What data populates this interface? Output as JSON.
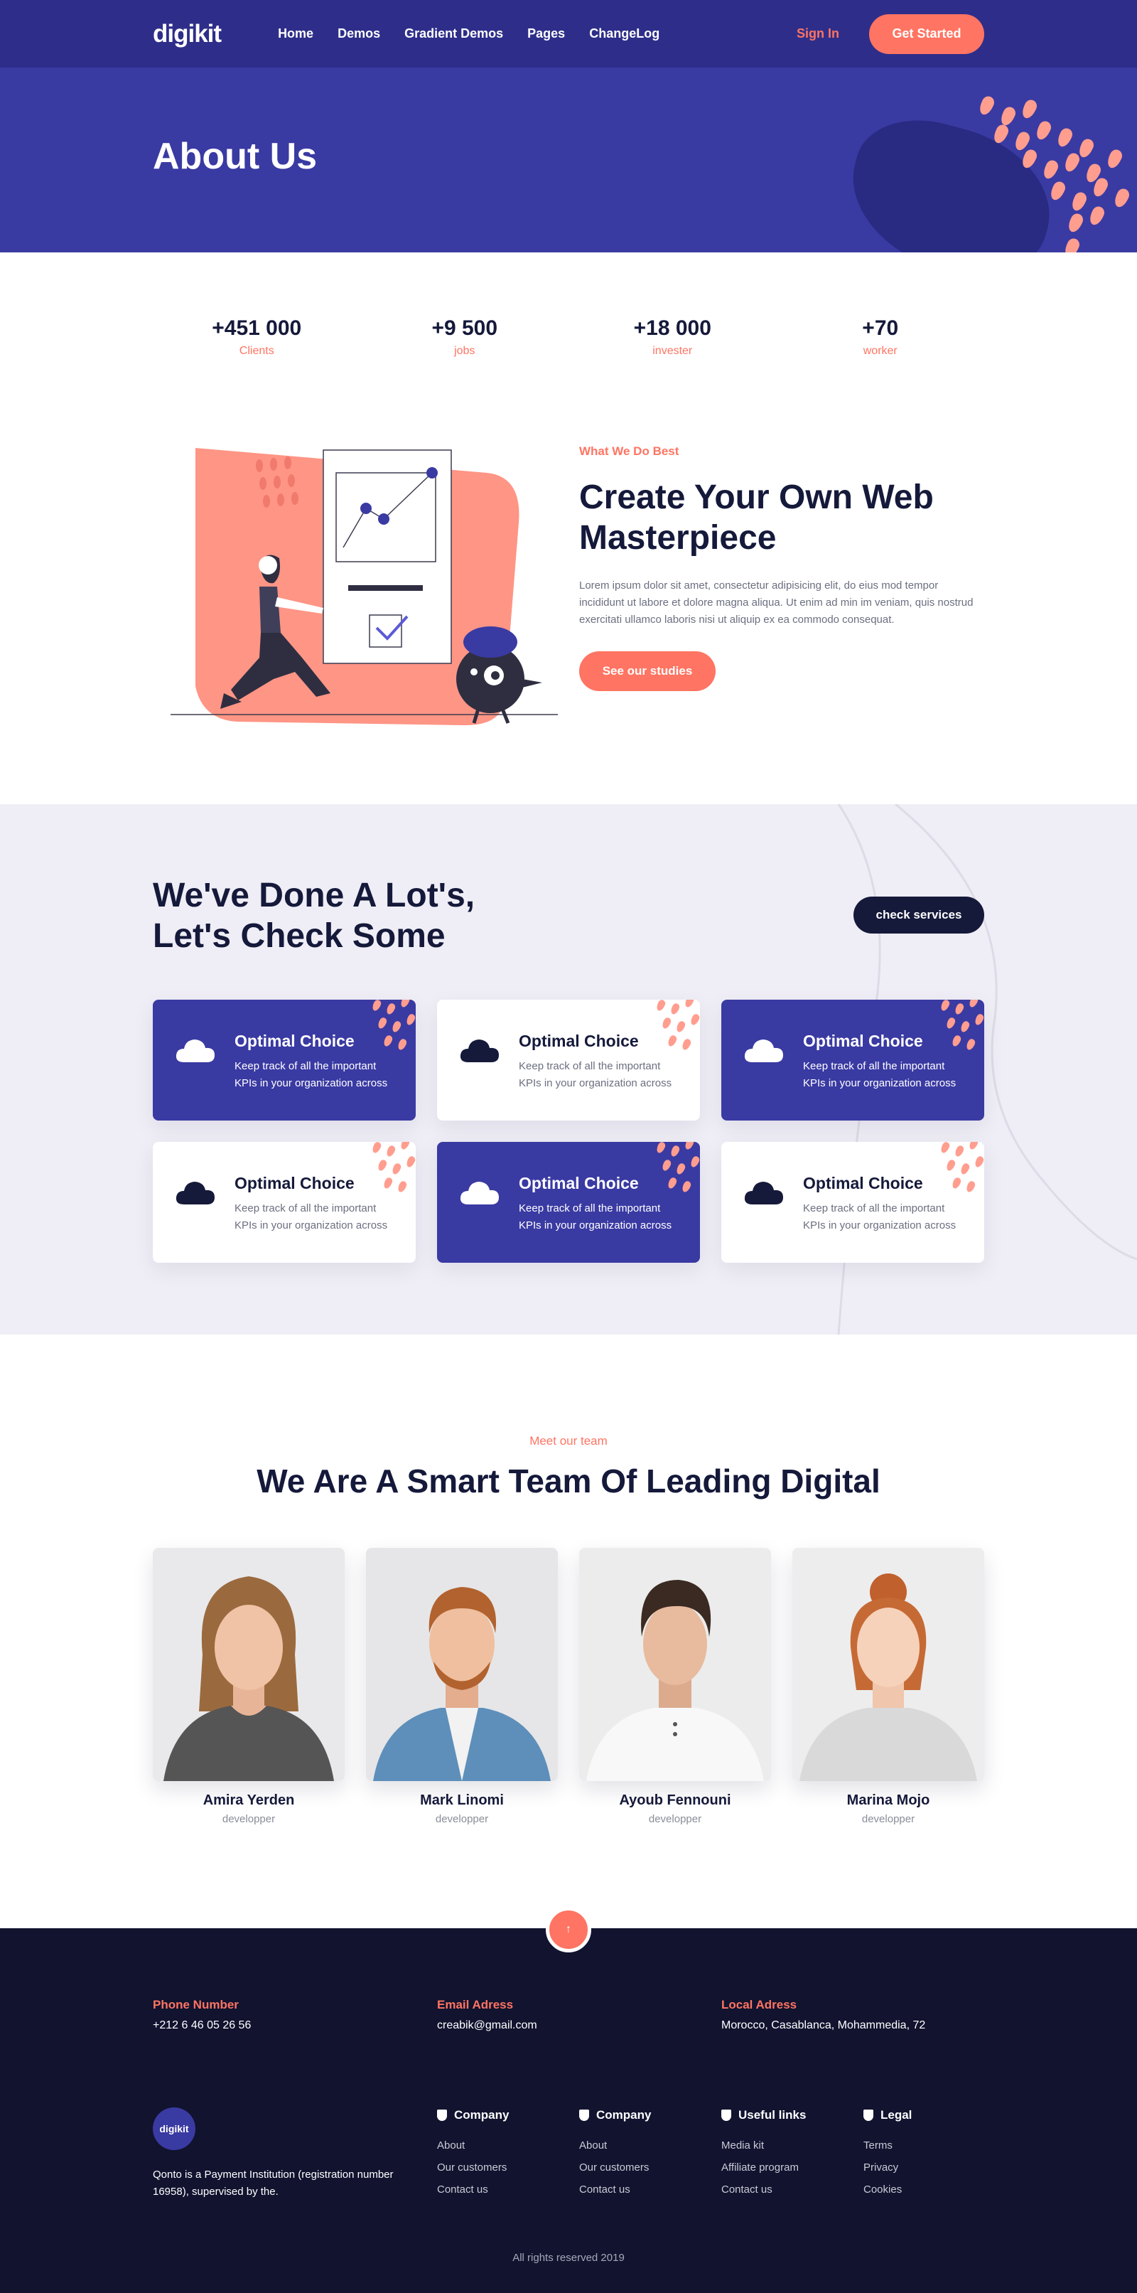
{
  "nav": {
    "logo": "digikit",
    "items": [
      "Home",
      "Demos",
      "Gradient Demos",
      "Pages",
      "ChangeLog"
    ],
    "signin": "Sign In",
    "cta": "Get Started"
  },
  "hero": {
    "title": "About Us"
  },
  "stats": [
    {
      "value": "+451 000",
      "label": "Clients"
    },
    {
      "value": "+9 500",
      "label": "jobs"
    },
    {
      "value": "+18 000",
      "label": "invester"
    },
    {
      "value": "+70",
      "label": "worker"
    }
  ],
  "about": {
    "eyebrow": "What We Do Best",
    "heading": "Create Your Own Web Masterpiece",
    "body": "Lorem ipsum dolor sit amet, consectetur adipisicing elit, do eius mod tempor incididunt ut labore et dolore magna aliqua. Ut enim ad min im veniam, quis nostrud exercitati ullamco laboris nisi ut aliquip ex ea commodo consequat.",
    "button": "See our studies"
  },
  "services": {
    "heading": "We've Done A Lot's, Let's Check Some",
    "button": "check services",
    "cards": [
      {
        "title": "Optimal Choice",
        "desc": "Keep track of all the important KPIs in your organization across",
        "icon": "cloud-icon",
        "style": "dark"
      },
      {
        "title": "Optimal Choice",
        "desc": "Keep track of all the important KPIs in your organization across",
        "icon": "cloud-icon",
        "style": "light"
      },
      {
        "title": "Optimal Choice",
        "desc": "Keep track of all the important KPIs in your organization across",
        "icon": "cloud-icon",
        "style": "dark"
      },
      {
        "title": "Optimal Choice",
        "desc": "Keep track of all the important KPIs in your organization across",
        "icon": "cloud-icon",
        "style": "light"
      },
      {
        "title": "Optimal Choice",
        "desc": "Keep track of all the important KPIs in your organization across",
        "icon": "cloud-icon",
        "style": "dark"
      },
      {
        "title": "Optimal Choice",
        "desc": "Keep track of all the important KPIs in your organization across",
        "icon": "cloud-icon",
        "style": "light"
      }
    ]
  },
  "team": {
    "eyebrow": "Meet our team",
    "heading": "We Are A Smart Team Of Leading Digital",
    "members": [
      {
        "name": "Amira Yerden",
        "role": "developper"
      },
      {
        "name": "Mark Linomi",
        "role": "developper"
      },
      {
        "name": "Ayoub Fennouni",
        "role": "developper"
      },
      {
        "name": "Marina Mojo",
        "role": "developper"
      }
    ]
  },
  "footer": {
    "back_to_top": "↑",
    "phone_label": "Phone Number",
    "phone": "+212 6 46 05 26 56",
    "email_label": "Email Adress",
    "email": "creabik@gmail.com",
    "address_label": "Local Adress",
    "address": "Morocco, Casablanca, Mohammedia, 72",
    "logo": "digikit",
    "about": "Qonto is a Payment Institution (registration number 16958), supervised by the.",
    "columns": [
      {
        "heading": "Company",
        "links": [
          "About",
          "Our customers",
          "Contact us"
        ]
      },
      {
        "heading": "Company",
        "links": [
          "About",
          "Our customers",
          "Contact us"
        ]
      },
      {
        "heading": "Useful links",
        "links": [
          "Media kit",
          "Affiliate program",
          "Contact us"
        ]
      },
      {
        "heading": "Legal",
        "links": [
          "Terms",
          "Privacy",
          "Cookies"
        ]
      }
    ],
    "copyright": "All rights reserved 2019"
  },
  "colors": {
    "primary": "#3a3aa3",
    "accent": "#ff7462",
    "dark": "#15193a",
    "footer": "#11132f"
  }
}
